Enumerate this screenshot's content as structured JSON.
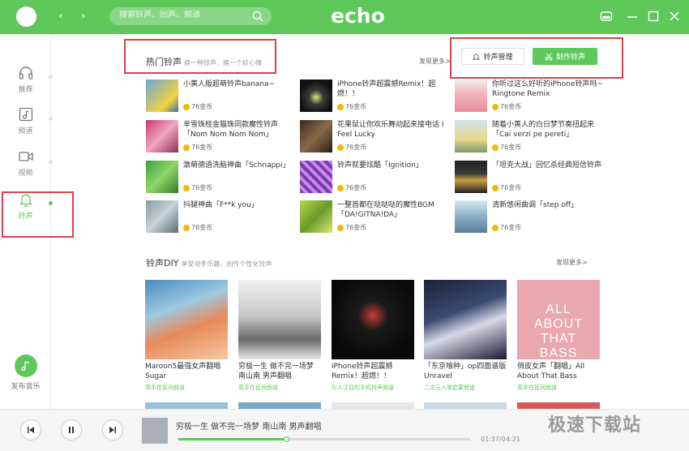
{
  "header": {
    "search_placeholder": "搜索铃声、回声、频道",
    "logo": "echo",
    "back_arrow": "‹",
    "forward_arrow": "›"
  },
  "sidebar": {
    "items": [
      {
        "label": "推荐",
        "icon": "headphones-icon"
      },
      {
        "label": "频道",
        "icon": "music-note-icon"
      },
      {
        "label": "视频",
        "icon": "video-icon"
      },
      {
        "label": "铃声",
        "icon": "bell-icon"
      }
    ],
    "publish_label": "发布音乐"
  },
  "hot": {
    "title": "热门铃声",
    "subtitle": "换一种铃声，换一个好心情",
    "more": "发现更多>",
    "manage_button": "铃声管理",
    "make_button": "制作铃声",
    "items": [
      {
        "title": "小黄人版超萌铃声banana~",
        "price": "76金币"
      },
      {
        "title": "iPhone铃声超震撼Remix！超燃！！",
        "price": "76金币"
      },
      {
        "title": "你听过这么好听的iPhone铃声吗~ Ringtone Remix",
        "price": "76金币"
      },
      {
        "title": "芈雪珠桂金猫珠同款魔性铃声「Nom Nom Nom Nom」",
        "price": "76金币"
      },
      {
        "title": "花果鼠让你欢乐舞动起来接电话 I Feel Lucky",
        "price": "76金币"
      },
      {
        "title": "随着小黄人的白日梦节奏扭起来「Cai verzi pe pereti」",
        "price": "76金币"
      },
      {
        "title": "激萌德语洗脑神曲「Schnappi」",
        "price": "76金币"
      },
      {
        "title": "铃声就要炫酷「Ignition」",
        "price": "76金币"
      },
      {
        "title": "「坦克大战」回忆杀经典短信铃声",
        "price": "76金币"
      },
      {
        "title": "抖腿神曲「F**k you」",
        "price": "76金币"
      },
      {
        "title": "一整首都在哒哒哒的魔性BGM「DA!GITNA!DA」",
        "price": "76金币"
      },
      {
        "title": "清新悠闲曲调「step off」",
        "price": "76金币"
      }
    ]
  },
  "diy": {
    "title": "铃声DIY",
    "subtitle": "享受动手乐趣，创作个性化铃声",
    "more": "发现更多>",
    "items": [
      {
        "title": "Maroon5最强女声翻唱Sugar",
        "sub": "高手在民间频道"
      },
      {
        "title": "穷极一生 做不完一场梦 南山南 男声翻唱",
        "sub": "高手在民间频道"
      },
      {
        "title": "iPhone铃声超震撼Remix！超燃！！",
        "sub": "引人注目的手机铃声频道"
      },
      {
        "title": "「东京喰种」op四面谱版 Unravel",
        "sub": "二次元人类启蒙频道"
      },
      {
        "title": "俏皮女声「翻唱」All About That Bass",
        "sub": "高手在民间频道"
      }
    ],
    "poster_text": "ALL ABOUT THAT BASS"
  },
  "player": {
    "title": "穷极一生 做不完一场梦 南山南 男声翻唱",
    "time": "01:37/04:21",
    "progress": 0.37
  },
  "watermark": "极速下载站",
  "colors": {
    "brand": "#5fc85a",
    "highlight": "#d9424b"
  }
}
